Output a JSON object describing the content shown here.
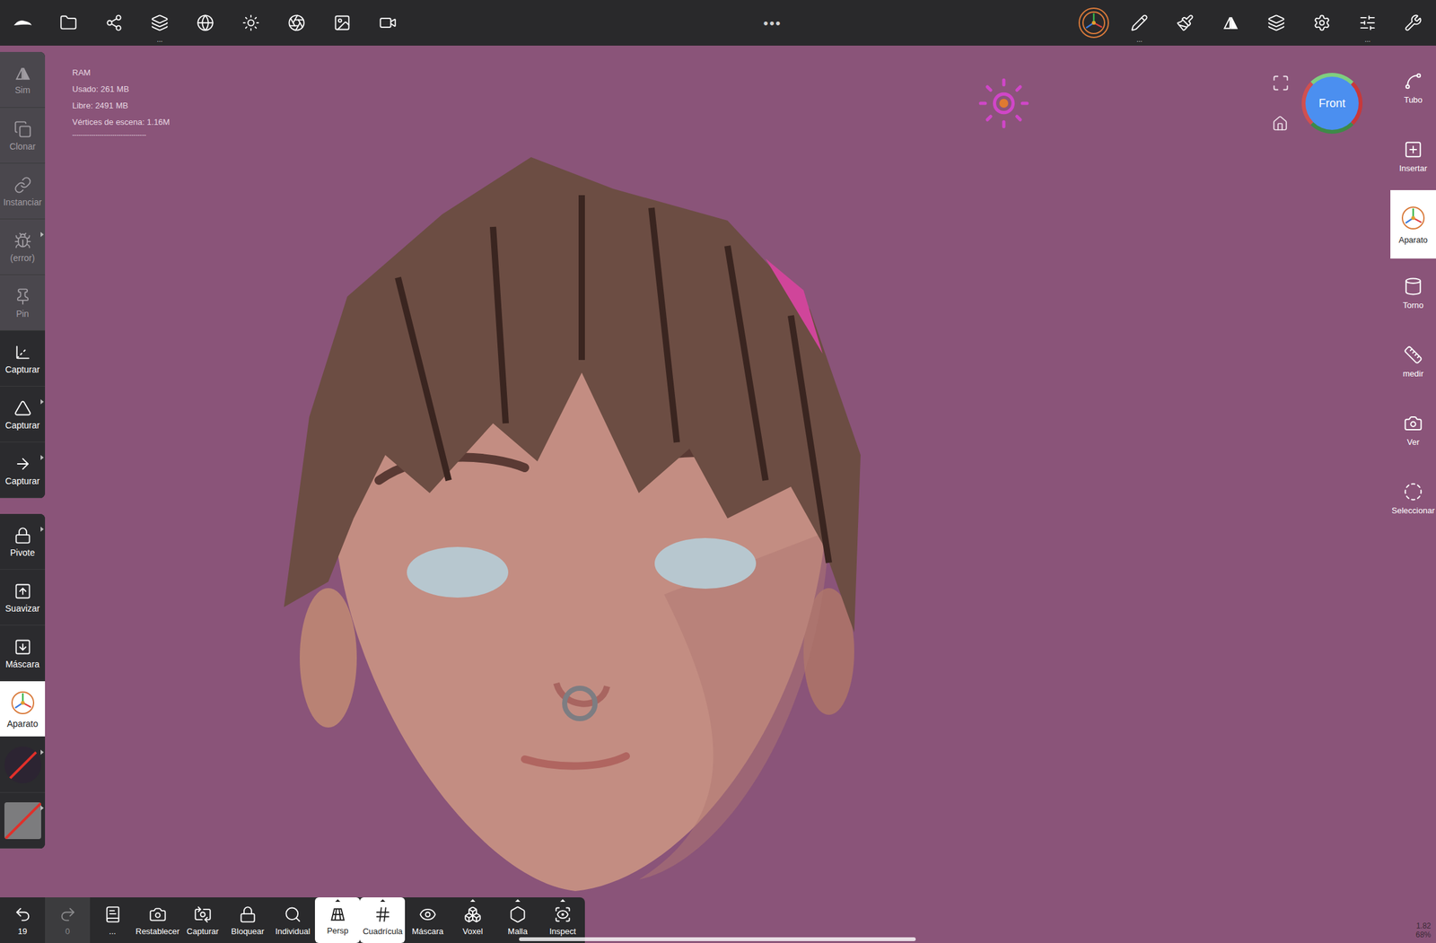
{
  "top_bar": {
    "more_mark": "...",
    "center": "•••",
    "left": [
      {
        "more": false
      },
      {
        "more": false
      },
      {
        "more": false
      },
      {
        "more": true
      },
      {
        "more": false
      },
      {
        "more": false
      },
      {
        "more": false
      },
      {
        "more": false
      },
      {
        "more": false
      }
    ],
    "right": [
      {
        "selected": true,
        "more": false
      },
      {
        "selected": false,
        "more": true
      },
      {
        "selected": false,
        "more": false
      },
      {
        "selected": false,
        "more": false
      },
      {
        "selected": false,
        "more": false
      },
      {
        "selected": false,
        "more": false
      },
      {
        "selected": false,
        "more": true
      },
      {
        "selected": false,
        "more": false
      }
    ]
  },
  "ram": {
    "title": "RAM",
    "lines": [
      "Usado: 261 MB",
      "Libre: 2491 MB",
      "Vértices de escena: 1.16M"
    ],
    "divider": "-----------------------------------"
  },
  "left_panel": {
    "groups": [
      [
        {
          "kind": "tool",
          "label": "Sim",
          "disabled": true,
          "selected": false,
          "submenu": false
        },
        {
          "kind": "tool",
          "label": "Clonar",
          "disabled": true,
          "selected": false,
          "submenu": false
        },
        {
          "kind": "tool",
          "label": "Instanciar",
          "disabled": true,
          "selected": false,
          "submenu": false
        },
        {
          "kind": "tool",
          "label": "(error)",
          "disabled": true,
          "selected": false,
          "submenu": true
        },
        {
          "kind": "tool",
          "label": "Pin",
          "disabled": true,
          "selected": false,
          "submenu": false
        },
        {
          "kind": "tool",
          "label": "Capturar",
          "disabled": false,
          "selected": false,
          "submenu": false
        },
        {
          "kind": "tool",
          "label": "Capturar",
          "disabled": false,
          "selected": false,
          "submenu": true
        },
        {
          "kind": "tool",
          "label": "Capturar",
          "disabled": false,
          "selected": false,
          "submenu": true
        }
      ],
      [
        {
          "kind": "tool",
          "label": "Pivote",
          "disabled": false,
          "selected": false,
          "submenu": true
        },
        {
          "kind": "tool",
          "label": "Suavizar",
          "disabled": false,
          "selected": false,
          "submenu": false
        },
        {
          "kind": "tool",
          "label": "Máscara",
          "disabled": false,
          "selected": false,
          "submenu": false
        },
        {
          "kind": "tool",
          "label": "Aparato",
          "disabled": false,
          "selected": true,
          "submenu": false
        },
        {
          "kind": "swatch",
          "label": "",
          "round": true,
          "color": "#2c2432",
          "disabled": false,
          "selected": false,
          "submenu": true
        },
        {
          "kind": "swatch",
          "label": "",
          "round": false,
          "color": "#7c7c7e",
          "disabled": false,
          "selected": false,
          "submenu": true
        }
      ]
    ]
  },
  "right_panel": [
    {
      "label": "Tubo",
      "selected": false
    },
    {
      "label": "Insertar",
      "selected": false
    },
    {
      "label": "Aparato",
      "selected": true
    },
    {
      "label": "Torno",
      "selected": false
    },
    {
      "label": "medir",
      "selected": false
    },
    {
      "label": "Ver",
      "selected": false
    },
    {
      "label": "Seleccionar",
      "selected": false
    }
  ],
  "viewport": {
    "camera": "Front"
  },
  "bottom_toolbar": [
    {
      "label": "19",
      "selected": false,
      "disabled": false,
      "submenu": false
    },
    {
      "label": "0",
      "selected": false,
      "disabled": true,
      "submenu": false
    },
    {
      "label": "...",
      "selected": false,
      "disabled": false,
      "submenu": false
    },
    {
      "label": "Restablecer",
      "selected": false,
      "disabled": false,
      "submenu": false
    },
    {
      "label": "Capturar",
      "selected": false,
      "disabled": false,
      "submenu": false
    },
    {
      "label": "Bloquear",
      "selected": false,
      "disabled": false,
      "submenu": false
    },
    {
      "label": "Individual",
      "selected": false,
      "disabled": false,
      "submenu": false
    },
    {
      "label": "Persp",
      "selected": true,
      "disabled": false,
      "submenu": true
    },
    {
      "label": "Cuadrícula",
      "selected": true,
      "disabled": false,
      "submenu": true
    },
    {
      "label": "Máscara",
      "selected": false,
      "disabled": false,
      "submenu": false
    },
    {
      "label": "Voxel",
      "selected": false,
      "disabled": false,
      "submenu": true
    },
    {
      "label": "Malla",
      "selected": false,
      "disabled": false,
      "submenu": true
    },
    {
      "label": "Inspect",
      "selected": false,
      "disabled": false,
      "submenu": true
    }
  ],
  "stats": [
    "1.82",
    "68%"
  ]
}
